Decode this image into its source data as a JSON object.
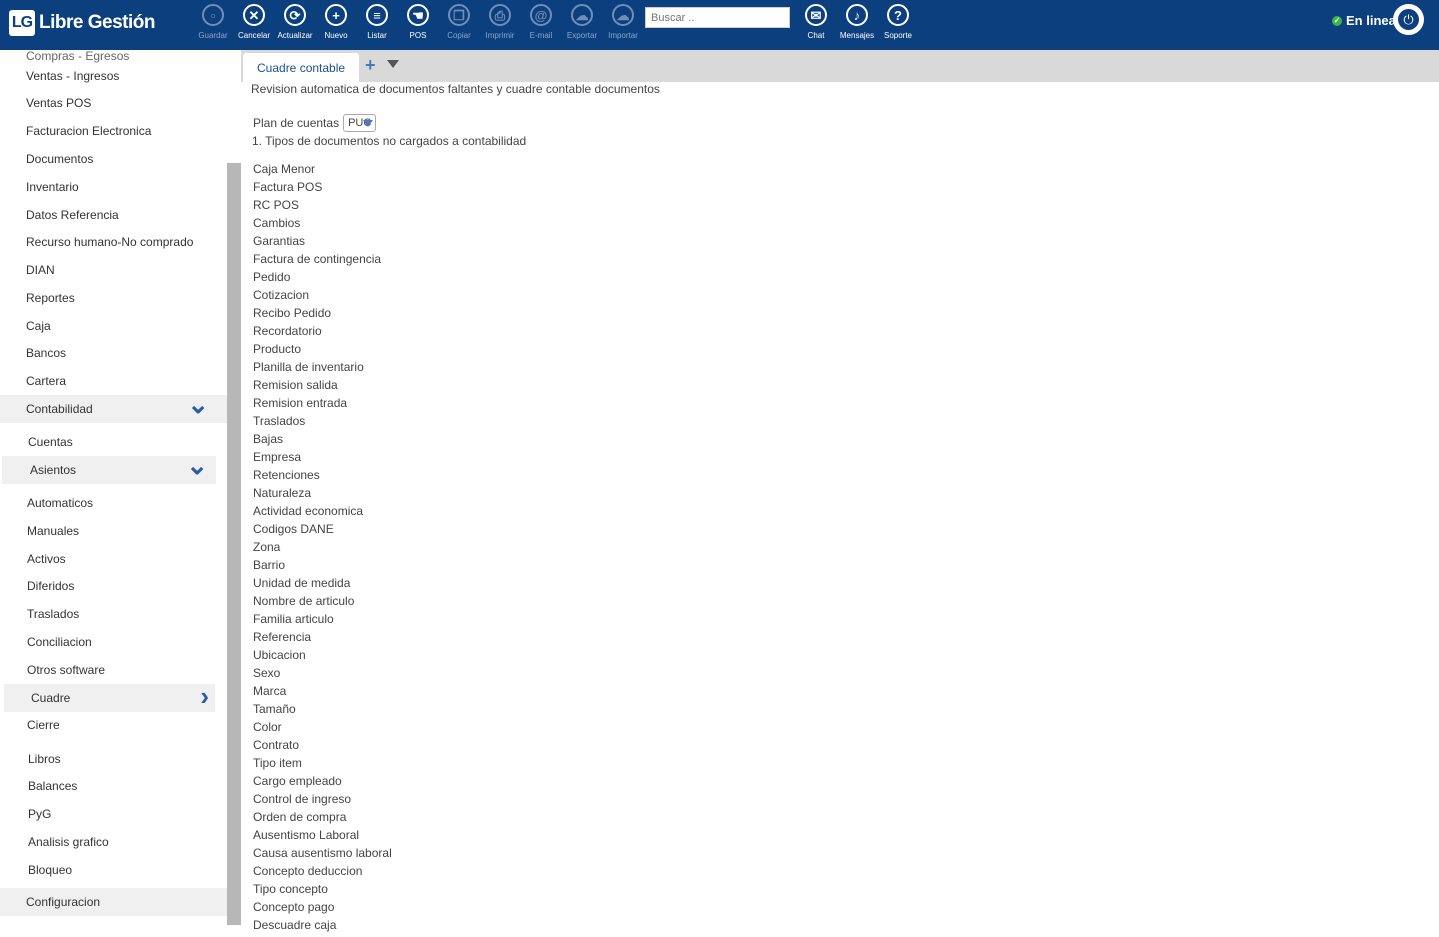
{
  "app": {
    "logo_mark": "LG",
    "logo_text": "Libre Gestión"
  },
  "toolbar": {
    "buttons": [
      {
        "label": "Guardar",
        "icon": "save-icon",
        "glyph": "▫",
        "enabled": false
      },
      {
        "label": "Cancelar",
        "icon": "cancel-icon",
        "glyph": "✕",
        "enabled": true
      },
      {
        "label": "Actualizar",
        "icon": "refresh-icon",
        "glyph": "⟳",
        "enabled": true
      },
      {
        "label": "Nuevo",
        "icon": "plus-icon",
        "glyph": "+",
        "enabled": true
      },
      {
        "label": "Listar",
        "icon": "list-icon",
        "glyph": "≡",
        "enabled": true
      },
      {
        "label": "POS",
        "icon": "pos-hand-icon",
        "glyph": "☚",
        "enabled": true
      },
      {
        "label": "Copiar",
        "icon": "copy-icon",
        "glyph": "❐",
        "enabled": false
      },
      {
        "label": "Imprimir",
        "icon": "print-icon",
        "glyph": "⎙",
        "enabled": false
      },
      {
        "label": "E-mail",
        "icon": "email-icon",
        "glyph": "@",
        "enabled": false
      },
      {
        "label": "Exportar",
        "icon": "export-icon",
        "glyph": "☁",
        "enabled": false
      },
      {
        "label": "Importar",
        "icon": "import-icon",
        "glyph": "☁",
        "enabled": false
      }
    ],
    "search_placeholder": "Buscar ..",
    "right_buttons": [
      {
        "label": "Chat",
        "icon": "chat-icon",
        "glyph": "✉"
      },
      {
        "label": "Mensajes",
        "icon": "bell-icon",
        "glyph": "♪"
      },
      {
        "label": "Soporte",
        "icon": "help-icon",
        "glyph": "?"
      }
    ],
    "status": "En linea",
    "status_color": "#3bb54a"
  },
  "sidebar": {
    "top_partial": "Compras - Egresos",
    "items": [
      {
        "label": "Ventas - Ingresos"
      },
      {
        "label": "Ventas POS"
      },
      {
        "label": "Facturacion Electronica"
      },
      {
        "label": "Documentos"
      },
      {
        "label": "Inventario"
      },
      {
        "label": "Datos Referencia"
      },
      {
        "label": "Recurso humano-No comprado"
      },
      {
        "label": "DIAN"
      },
      {
        "label": "Reportes"
      },
      {
        "label": "Caja"
      },
      {
        "label": "Bancos"
      },
      {
        "label": "Cartera"
      },
      {
        "label": "Contabilidad"
      }
    ],
    "contabilidad_children": [
      {
        "label": "Cuentas"
      },
      {
        "label": "Asientos"
      }
    ],
    "asientos_children": [
      {
        "label": "Automaticos"
      },
      {
        "label": "Manuales"
      },
      {
        "label": "Activos"
      },
      {
        "label": "Diferidos"
      },
      {
        "label": "Traslados"
      },
      {
        "label": "Conciliacion"
      },
      {
        "label": "Otros software"
      },
      {
        "label": "Cuadre"
      },
      {
        "label": "Cierre"
      }
    ],
    "contabilidad_more": [
      {
        "label": "Libros"
      },
      {
        "label": "Balances"
      },
      {
        "label": "PyG"
      },
      {
        "label": "Analisis grafico"
      },
      {
        "label": "Bloqueo"
      }
    ],
    "bottom": {
      "label": "Configuracion"
    }
  },
  "tabs": {
    "active": "Cuadre contable"
  },
  "main": {
    "description": "Revision automatica de documentos faltantes y cuadre contable documentos",
    "plan_label": "Plan de cuentas",
    "plan_value": "PUC",
    "section_title": "1. Tipos de documentos no cargados a contabilidad",
    "documents": [
      "Caja Menor",
      "Factura POS",
      "RC POS",
      "Cambios",
      "Garantias",
      "Factura de contingencia",
      "Pedido",
      "Cotizacion",
      "Recibo Pedido",
      "Recordatorio",
      "Producto",
      "Planilla de inventario",
      "Remision salida",
      "Remision entrada",
      "Traslados",
      "Bajas",
      "Empresa",
      "Retenciones",
      "Naturaleza",
      "Actividad economica",
      "Codigos DANE",
      "Zona",
      "Barrio",
      "Unidad de medida",
      "Nombre de articulo",
      "Familia articulo",
      "Referencia",
      "Ubicacion",
      "Sexo",
      "Marca",
      "Tamaño",
      "Color",
      "Contrato",
      "Tipo item",
      "Cargo empleado",
      "Control de ingreso",
      "Orden de compra",
      "Ausentismo Laboral",
      "Causa ausentismo laboral",
      "Concepto deduccion",
      "Tipo concepto",
      "Concepto pago",
      "Descuadre caja"
    ]
  }
}
